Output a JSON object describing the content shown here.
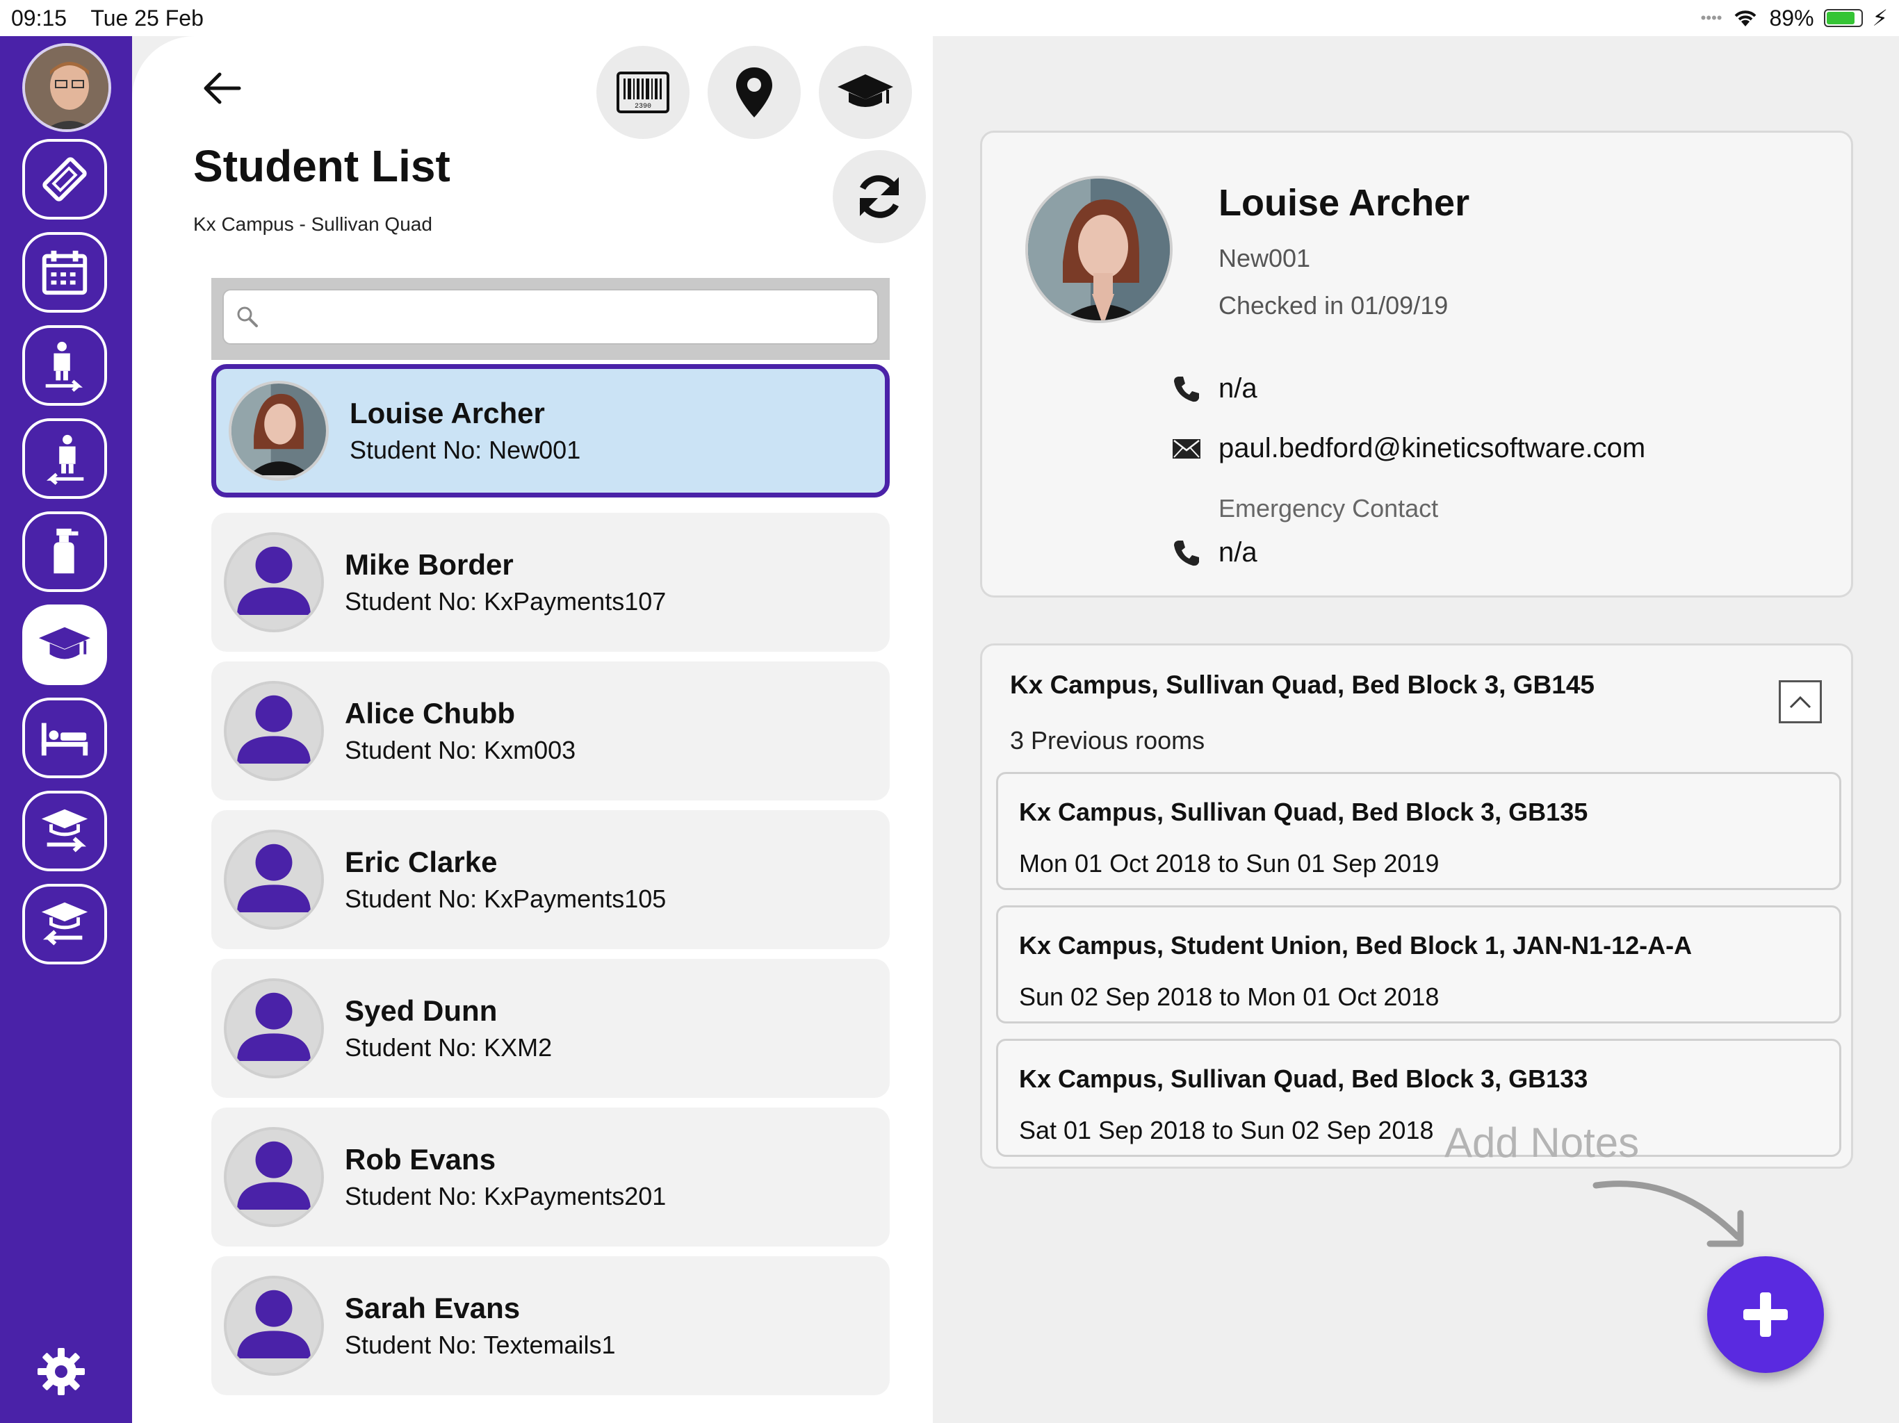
{
  "status_bar": {
    "time": "09:15",
    "date": "Tue 25 Feb",
    "battery": "89%"
  },
  "rail": {
    "items": [
      {
        "name": "ticket-icon",
        "active": false
      },
      {
        "name": "calendar-icon",
        "active": false
      },
      {
        "name": "check-in-icon",
        "active": false
      },
      {
        "name": "check-out-icon",
        "active": false
      },
      {
        "name": "cleaning-spray-icon",
        "active": false
      },
      {
        "name": "graduation-cap-icon",
        "active": true
      },
      {
        "name": "bed-icon",
        "active": false
      },
      {
        "name": "student-arrival-icon",
        "active": false
      },
      {
        "name": "student-departure-icon",
        "active": false
      }
    ],
    "settings_icon": "gear-icon"
  },
  "header": {
    "title": "Student List",
    "subtitle": "Kx Campus - Sullivan Quad",
    "tools": [
      "barcode-icon",
      "location-pin-icon",
      "graduation-cap-icon",
      "refresh-icon"
    ]
  },
  "search": {
    "placeholder": "",
    "value": ""
  },
  "students": [
    {
      "name": "Louise Archer",
      "number": "Student No: New001",
      "selected": true,
      "has_photo": true
    },
    {
      "name": "Mike Border",
      "number": "Student No: KxPayments107",
      "selected": false,
      "has_photo": false
    },
    {
      "name": "Alice Chubb",
      "number": "Student No: Kxm003",
      "selected": false,
      "has_photo": false
    },
    {
      "name": "Eric Clarke",
      "number": "Student No: KxPayments105",
      "selected": false,
      "has_photo": false
    },
    {
      "name": "Syed Dunn",
      "number": "Student No: KXM2",
      "selected": false,
      "has_photo": false
    },
    {
      "name": "Rob Evans",
      "number": "Student No: KxPayments201",
      "selected": false,
      "has_photo": false
    },
    {
      "name": "Sarah Evans",
      "number": "Student No: Textemails1",
      "selected": false,
      "has_photo": false
    }
  ],
  "detail": {
    "name": "Louise Archer",
    "id": "New001",
    "checked_in": "Checked in 01/09/19",
    "phone": "n/a",
    "email": "paul.bedford@kineticsoftware.com",
    "emergency_label": "Emergency Contact",
    "emergency_phone": "n/a"
  },
  "rooms": {
    "current": "Kx Campus, Sullivan Quad, Bed Block 3, GB145",
    "previous_label": "3 Previous rooms",
    "previous": [
      {
        "room": "Kx Campus, Sullivan Quad, Bed Block 3, GB135",
        "dates": "Mon 01 Oct 2018 to Sun 01 Sep 2019"
      },
      {
        "room": "Kx Campus, Student Union, Bed Block 1, JAN-N1-12-A-A",
        "dates": "Sun 02 Sep 2018 to Mon 01 Oct 2018"
      },
      {
        "room": "Kx Campus, Sullivan Quad, Bed Block 3, GB133",
        "dates": "Sat 01 Sep 2018 to Sun 02 Sep 2018"
      }
    ]
  },
  "notes": {
    "hint": "Add Notes"
  },
  "colors": {
    "brand": "#4a22a8",
    "fab": "#5a2ae0",
    "selected_bg": "#cbe3f5"
  }
}
